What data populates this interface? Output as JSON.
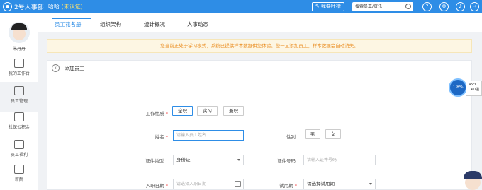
{
  "topbar": {
    "logo_text": "2号人事部",
    "company_name": "哈哈",
    "company_status": "(未认证)",
    "feedback_label": "我要吐槽",
    "search_placeholder": "搜索员工/资讯",
    "icons": [
      "help-icon",
      "settings-icon",
      "bell-icon",
      "logout-icon"
    ]
  },
  "sidebar": {
    "username": "朱丹丹",
    "items": [
      {
        "label": "我的工作台",
        "icon": "monitor-icon"
      },
      {
        "label": "员工管理",
        "icon": "staff-icon",
        "active": true
      },
      {
        "label": "社保公积金",
        "icon": "home-icon"
      },
      {
        "label": "员工福利",
        "icon": "gift-icon"
      },
      {
        "label": "薪酬",
        "icon": "salary-icon"
      }
    ]
  },
  "tabs": [
    {
      "label": "员工花名册",
      "active": true
    },
    {
      "label": "组织架构"
    },
    {
      "label": "统计概况"
    },
    {
      "label": "人事动态"
    }
  ],
  "notice": "您当前正处于学习模式，系统已提供样本数据供您体验。您一旦添加员工，样本数据会自动消失。",
  "panel": {
    "title": "添加员工",
    "work_type": {
      "label": "工作性质",
      "options": [
        "全职",
        "实习",
        "兼职"
      ],
      "selected": "全职"
    },
    "name": {
      "label": "姓名",
      "placeholder": "请输入员工姓名"
    },
    "gender": {
      "label": "性别",
      "options": [
        "男",
        "女"
      ]
    },
    "id_type": {
      "label": "证件类型",
      "value": "身份证"
    },
    "id_number": {
      "label": "证件号码",
      "placeholder": "请输入证件号码"
    },
    "hire_date": {
      "label": "入职日期",
      "placeholder": "请选择入职日期"
    },
    "probation": {
      "label": "试用期",
      "value": "请选择试用期"
    }
  },
  "widget": {
    "cpu_percent": "1.8%",
    "temperature": "45°C",
    "cpu_label": "CPU温"
  }
}
